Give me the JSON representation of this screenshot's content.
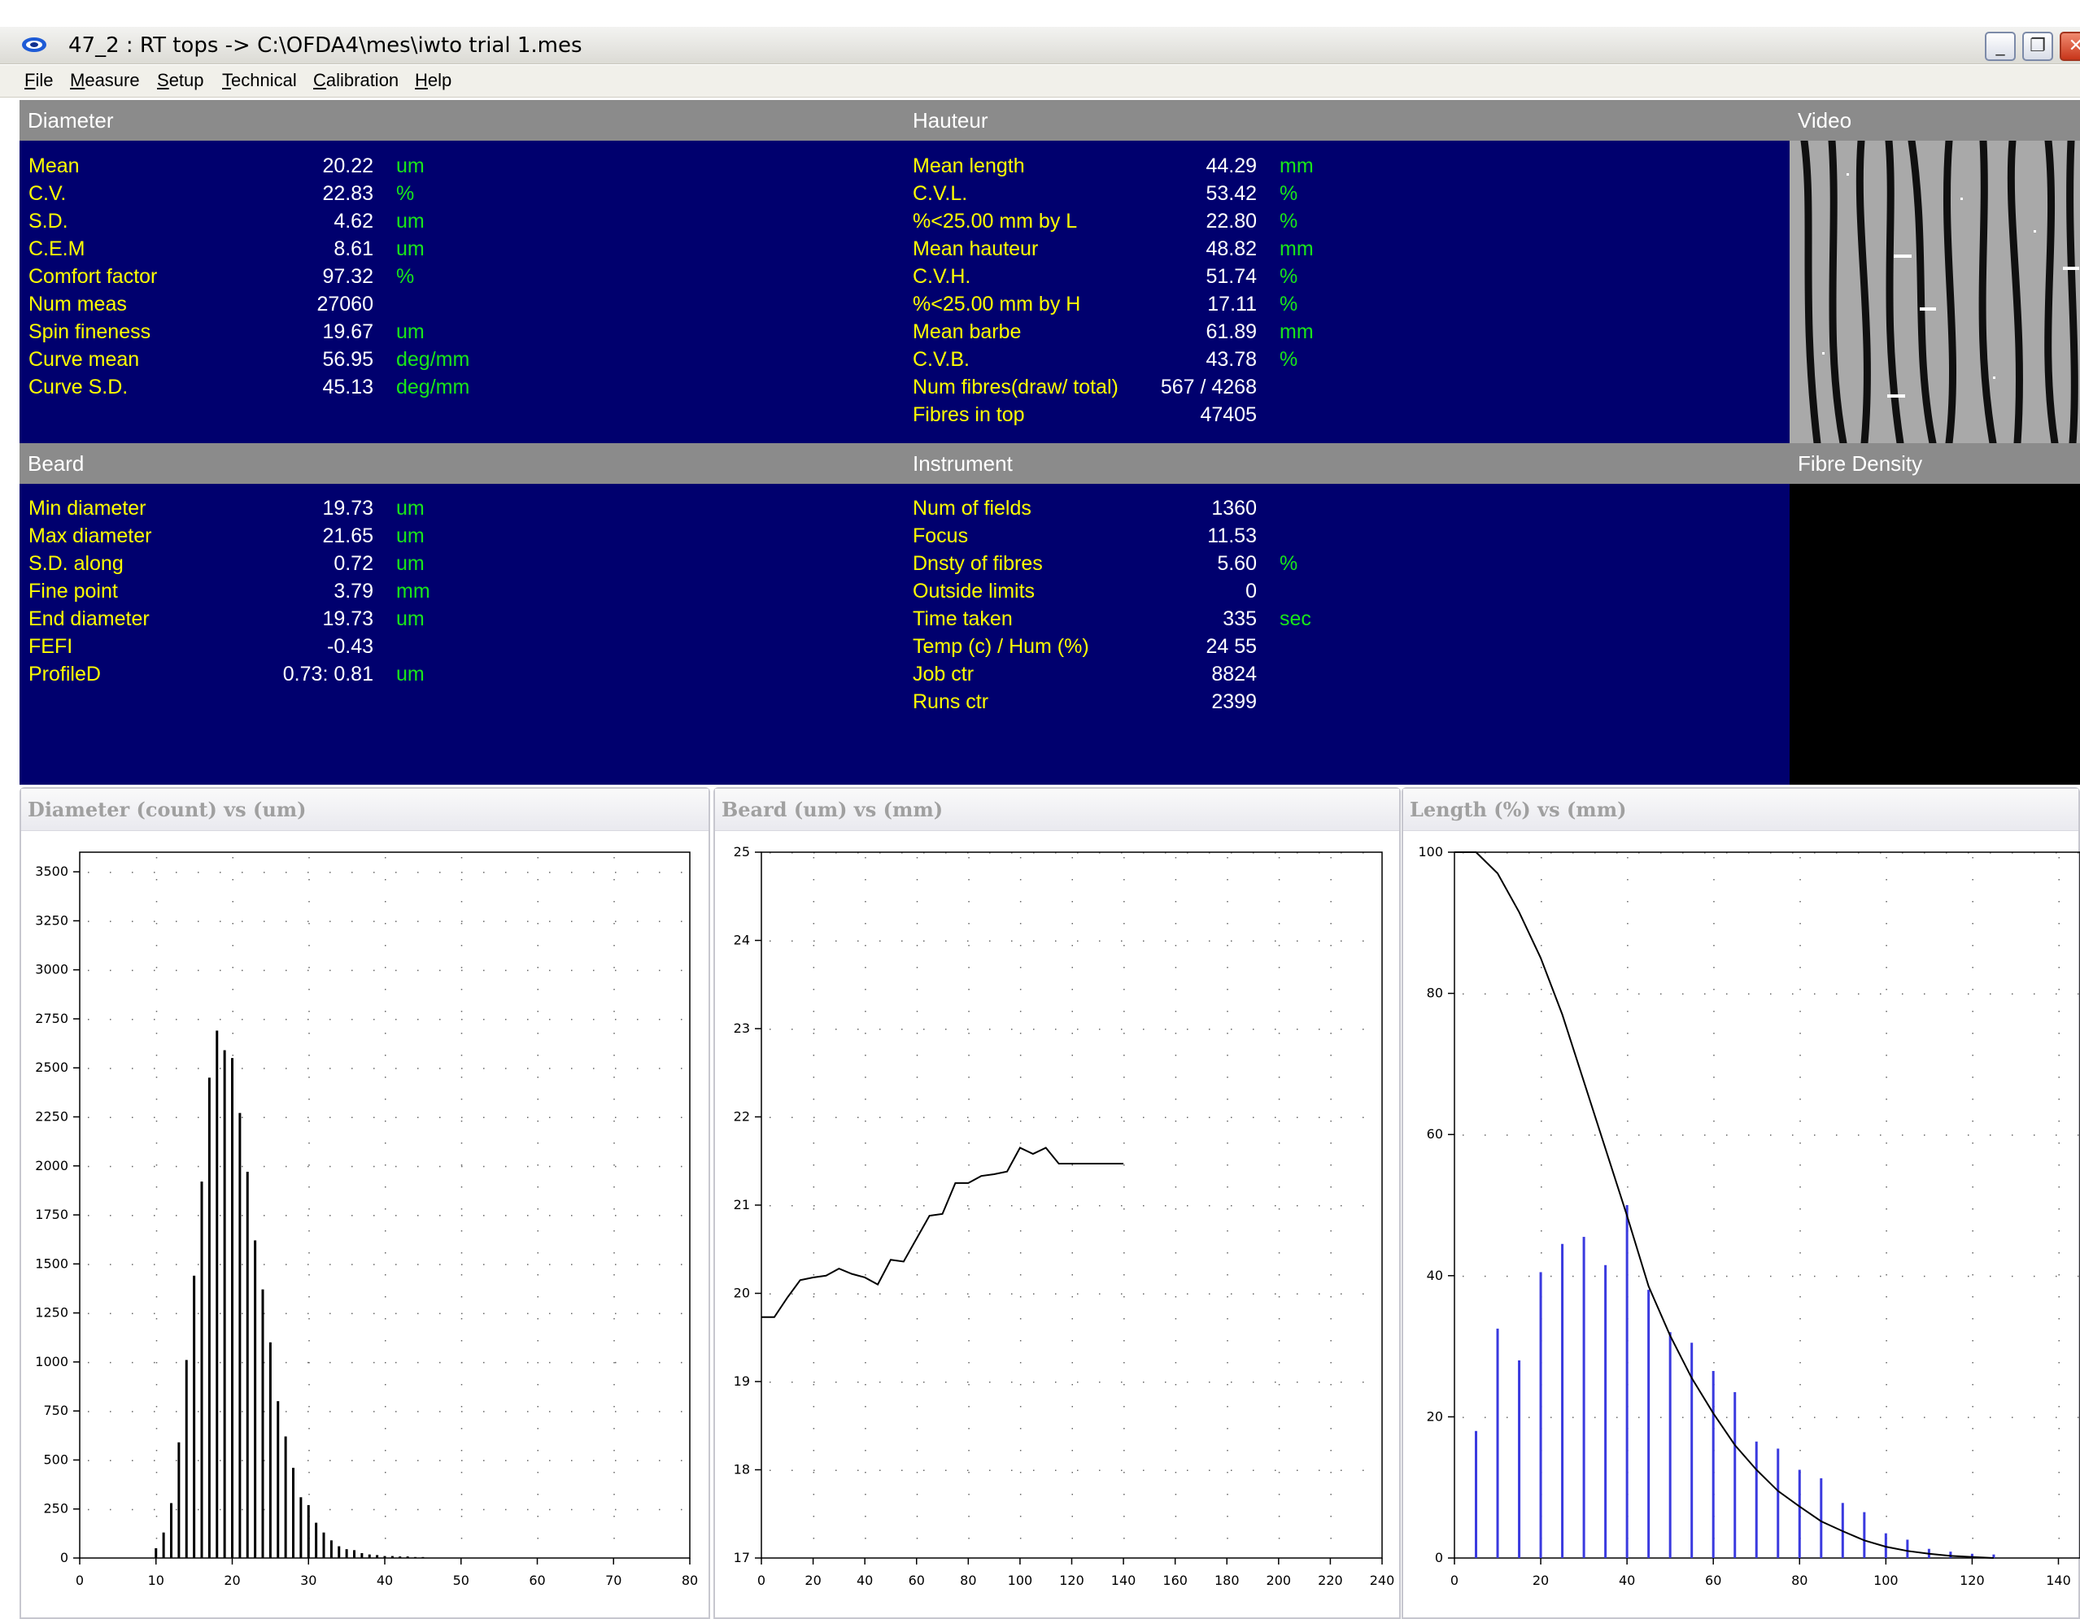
{
  "window": {
    "title": "47_2 : RT tops -> C:\\OFDA4\\mes\\iwto trial 1.mes",
    "minimize_glyph": "_",
    "maximize_glyph": "❐",
    "close_glyph": "✕"
  },
  "menu": [
    {
      "accel": "F",
      "rest": "ile"
    },
    {
      "accel": "M",
      "rest": "easure"
    },
    {
      "accel": "S",
      "rest": "etup"
    },
    {
      "accel": "T",
      "rest": "echnical"
    },
    {
      "accel": "C",
      "rest": "alibration"
    },
    {
      "accel": "H",
      "rest": "elp"
    }
  ],
  "sections": {
    "diameter": "Diameter",
    "hauteur": "Hauteur",
    "video": "Video",
    "beard": "Beard",
    "instrument": "Instrument",
    "fibre_density": "Fibre Density"
  },
  "diameter_rows": [
    {
      "label": "Mean",
      "value": "20.22",
      "unit": "um"
    },
    {
      "label": "C.V.",
      "value": "22.83",
      "unit": "%"
    },
    {
      "label": "S.D.",
      "value": "4.62",
      "unit": "um"
    },
    {
      "label": "C.E.M",
      "value": "8.61",
      "unit": "um"
    },
    {
      "label": "Comfort factor",
      "value": "97.32",
      "unit": "%"
    },
    {
      "label": "Num meas",
      "value": "27060",
      "unit": ""
    },
    {
      "label": "Spin fineness",
      "value": "19.67",
      "unit": "um"
    },
    {
      "label": "Curve mean",
      "value": "56.95",
      "unit": "deg/mm"
    },
    {
      "label": "Curve S.D.",
      "value": "45.13",
      "unit": "deg/mm"
    }
  ],
  "hauteur_rows": [
    {
      "label": "Mean length",
      "value": "44.29",
      "unit": "mm"
    },
    {
      "label": "C.V.L.",
      "value": "53.42",
      "unit": "%"
    },
    {
      "label": "%<25.00 mm by L",
      "value": "22.80",
      "unit": "%"
    },
    {
      "label": "Mean hauteur",
      "value": "48.82",
      "unit": "mm"
    },
    {
      "label": "C.V.H.",
      "value": "51.74",
      "unit": "%"
    },
    {
      "label": "%<25.00 mm by H",
      "value": "17.11",
      "unit": "%"
    },
    {
      "label": "Mean barbe",
      "value": "61.89",
      "unit": "mm"
    },
    {
      "label": "C.V.B.",
      "value": "43.78",
      "unit": "%"
    },
    {
      "label": "Num fibres(draw/ total)",
      "value": "567 / 4268",
      "unit": ""
    },
    {
      "label": "Fibres in top",
      "value": "47405",
      "unit": ""
    }
  ],
  "beard_rows": [
    {
      "label": "Min diameter",
      "value": "19.73",
      "unit": "um"
    },
    {
      "label": "Max diameter",
      "value": "21.65",
      "unit": "um"
    },
    {
      "label": "S.D. along",
      "value": "0.72",
      "unit": "um"
    },
    {
      "label": "Fine point",
      "value": "3.79",
      "unit": "mm"
    },
    {
      "label": "End diameter",
      "value": "19.73",
      "unit": "um"
    },
    {
      "label": "FEFI",
      "value": "-0.43",
      "unit": ""
    },
    {
      "label": "ProfileD",
      "value": "0.73: 0.81",
      "unit": "um"
    }
  ],
  "instrument_rows": [
    {
      "label": "Num of fields",
      "value": "1360",
      "unit": ""
    },
    {
      "label": "Focus",
      "value": "11.53",
      "unit": ""
    },
    {
      "label": "Dnsty of fibres",
      "value": "5.60",
      "unit": "%"
    },
    {
      "label": "Outside limits",
      "value": "0",
      "unit": ""
    },
    {
      "label": "Time taken",
      "value": "335",
      "unit": "sec"
    },
    {
      "label": "Temp (c) / Hum (%)",
      "value": "24   55",
      "unit": ""
    },
    {
      "label": "Job ctr",
      "value": "8824",
      "unit": ""
    },
    {
      "label": "Runs ctr",
      "value": "2399",
      "unit": ""
    }
  ],
  "colors": {
    "panel_bg": "#00006e",
    "label": "#ffff00",
    "value": "#ffffff",
    "unit": "#19e619",
    "header_bg": "#8b8b8b",
    "length_bars": "#3a3adf"
  },
  "chart_data": [
    {
      "type": "bar",
      "title": "Diameter (count) vs (um)",
      "xlim": [
        0,
        80
      ],
      "ylim": [
        0,
        3600
      ],
      "xticks": [
        0,
        10,
        20,
        30,
        40,
        50,
        60,
        70,
        80
      ],
      "yticks": [
        0,
        250,
        500,
        750,
        1000,
        1250,
        1500,
        1750,
        2000,
        2250,
        2500,
        2750,
        3000,
        3250,
        3500
      ],
      "x": [
        10,
        11,
        12,
        13,
        14,
        15,
        16,
        17,
        18,
        19,
        20,
        21,
        22,
        23,
        24,
        25,
        26,
        27,
        28,
        29,
        30,
        31,
        32,
        33,
        34,
        35,
        36,
        37,
        38,
        39,
        40,
        41,
        42,
        43,
        44,
        45
      ],
      "values": [
        50,
        130,
        280,
        590,
        1010,
        1440,
        1920,
        2450,
        2690,
        2590,
        2550,
        2270,
        1970,
        1620,
        1370,
        1100,
        800,
        620,
        460,
        310,
        270,
        180,
        130,
        90,
        60,
        45,
        40,
        25,
        18,
        15,
        10,
        10,
        8,
        8,
        5,
        5
      ]
    },
    {
      "type": "line",
      "title": "Beard (um) vs (mm)",
      "xlim": [
        0,
        240
      ],
      "ylim": [
        17,
        25
      ],
      "xticks": [
        0,
        20,
        40,
        60,
        80,
        100,
        120,
        140,
        160,
        180,
        200,
        220,
        240
      ],
      "yticks": [
        17,
        18,
        19,
        20,
        21,
        22,
        23,
        24,
        25
      ],
      "x": [
        0,
        5,
        10,
        15,
        20,
        25,
        30,
        35,
        40,
        45,
        50,
        55,
        60,
        65,
        70,
        75,
        80,
        85,
        90,
        95,
        100,
        105,
        110,
        115,
        120,
        125,
        130,
        135,
        140
      ],
      "values": [
        19.73,
        19.73,
        19.95,
        20.15,
        20.18,
        20.2,
        20.28,
        20.22,
        20.18,
        20.1,
        20.38,
        20.36,
        20.62,
        20.88,
        20.9,
        21.25,
        21.25,
        21.33,
        21.35,
        21.38,
        21.65,
        21.58,
        21.65,
        21.47,
        21.47,
        21.47,
        21.47,
        21.47,
        21.47
      ]
    },
    {
      "type": "bar",
      "title": "Length (%) vs (mm)",
      "xlim": [
        0,
        145
      ],
      "ylim": [
        0,
        100
      ],
      "xticks": [
        0,
        20,
        40,
        60,
        80,
        100,
        120,
        140
      ],
      "yticks": [
        0,
        20,
        40,
        60,
        80,
        100
      ],
      "series": [
        {
          "kind": "bar",
          "x": [
            5,
            10,
            15,
            20,
            25,
            30,
            35,
            40,
            45,
            50,
            55,
            60,
            65,
            70,
            75,
            80,
            85,
            90,
            95,
            100,
            105,
            110,
            115,
            120,
            125
          ],
          "values": [
            18,
            32.5,
            28,
            40.5,
            44.5,
            45.5,
            41.5,
            50,
            38,
            32,
            30.5,
            26.5,
            23.5,
            16.5,
            15.5,
            12.5,
            11.3,
            7.8,
            6.5,
            3.5,
            2.6,
            1.3,
            0.9,
            0.6,
            0.5
          ]
        },
        {
          "kind": "line",
          "x": [
            0,
            5,
            10,
            15,
            20,
            25,
            30,
            35,
            40,
            45,
            50,
            55,
            60,
            65,
            70,
            75,
            80,
            85,
            90,
            95,
            100,
            105,
            110,
            115,
            120,
            125
          ],
          "values": [
            100,
            100,
            97,
            91.5,
            85,
            77,
            67.5,
            58,
            48.5,
            38.5,
            31.5,
            25.5,
            20.5,
            16,
            12.5,
            9.5,
            7.3,
            5.2,
            3.8,
            2.5,
            1.6,
            1,
            0.6,
            0.3,
            0.15,
            0
          ]
        }
      ]
    }
  ]
}
